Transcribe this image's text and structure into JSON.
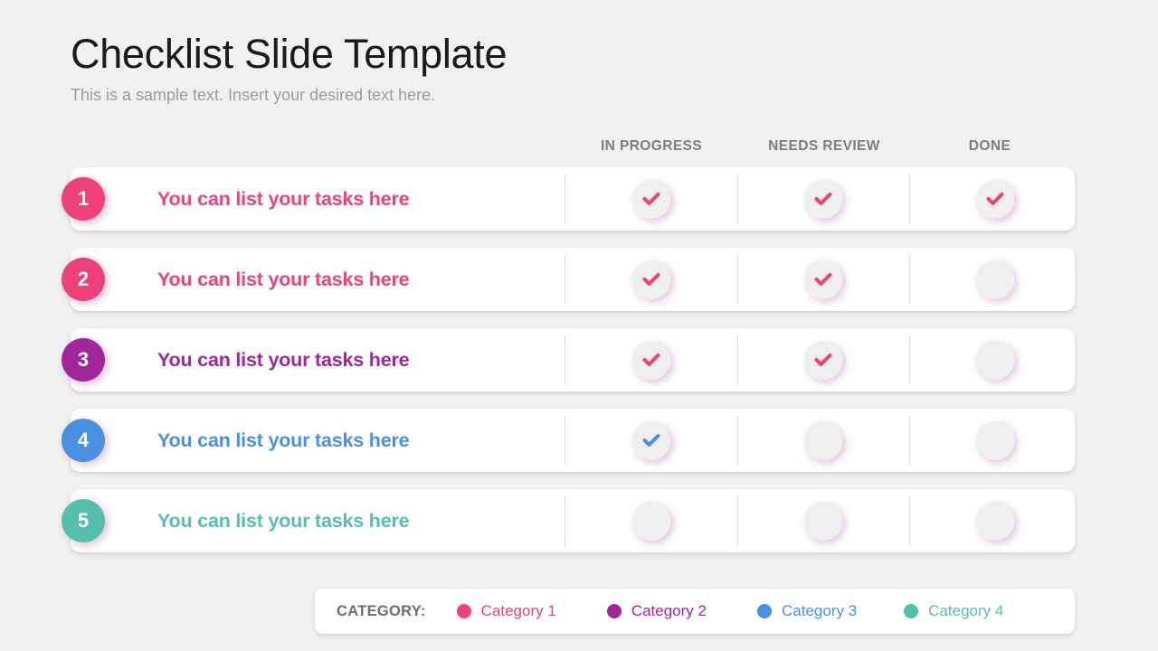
{
  "header": {
    "title": "Checklist Slide Template",
    "subtitle": "This is a sample text. Insert your desired text here."
  },
  "columns": [
    {
      "label": "IN PROGRESS"
    },
    {
      "label": "NEEDS REVIEW"
    },
    {
      "label": "DONE"
    }
  ],
  "colors": {
    "background": "#f1f1f1",
    "card": "#ffffff",
    "category_1": "#ef4179",
    "category_2": "#a0269a",
    "category_3": "#4a90e2",
    "category_4": "#55bfae",
    "header_text": "#7d7d7d",
    "empty_circle": "#f0eff0",
    "check_default": "#ef4179"
  },
  "rows": [
    {
      "number": "1",
      "label": "You can list your tasks here",
      "color": "#ef4179",
      "statuses": [
        {
          "checked": true,
          "check_color": "#ef4179"
        },
        {
          "checked": true,
          "check_color": "#ef4179"
        },
        {
          "checked": true,
          "check_color": "#ef4179"
        }
      ]
    },
    {
      "number": "2",
      "label": "You can list your tasks here",
      "color": "#ef4179",
      "statuses": [
        {
          "checked": true,
          "check_color": "#ef4179"
        },
        {
          "checked": true,
          "check_color": "#ef4179"
        },
        {
          "checked": false,
          "check_color": "#ef4179"
        }
      ]
    },
    {
      "number": "3",
      "label": "You can list your tasks here",
      "color": "#a0269a",
      "statuses": [
        {
          "checked": true,
          "check_color": "#ef4179"
        },
        {
          "checked": true,
          "check_color": "#ef4179"
        },
        {
          "checked": false,
          "check_color": "#ef4179"
        }
      ]
    },
    {
      "number": "4",
      "label": "You can list your tasks here",
      "color": "#4a90e2",
      "statuses": [
        {
          "checked": true,
          "check_color": "#4a90e2"
        },
        {
          "checked": false,
          "check_color": "#4a90e2"
        },
        {
          "checked": false,
          "check_color": "#4a90e2"
        }
      ]
    },
    {
      "number": "5",
      "label": "You can list your tasks here",
      "color": "#55bfae",
      "statuses": [
        {
          "checked": false,
          "check_color": "#55bfae"
        },
        {
          "checked": false,
          "check_color": "#55bfae"
        },
        {
          "checked": false,
          "check_color": "#55bfae"
        }
      ]
    }
  ],
  "legend": {
    "title": "CATEGORY:",
    "items": [
      {
        "label": "Category 1",
        "color": "#ef4179"
      },
      {
        "label": "Category 2",
        "color": "#a0269a"
      },
      {
        "label": "Category 3",
        "color": "#4a90e2"
      },
      {
        "label": "Category 4",
        "color": "#55bfae"
      }
    ]
  }
}
